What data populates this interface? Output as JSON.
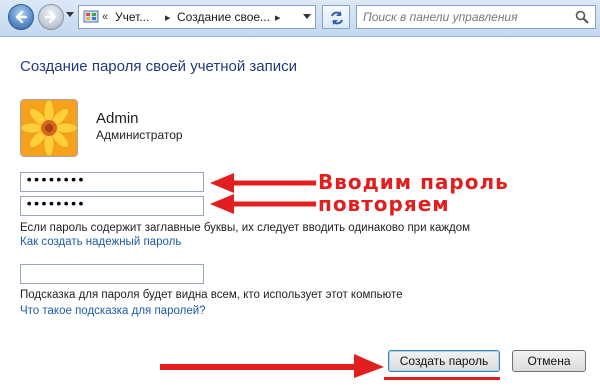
{
  "nav": {
    "breadcrumbs": [
      "Учет...",
      "Создание свое..."
    ],
    "search_placeholder": "Поиск в панели управления"
  },
  "page": {
    "heading": "Создание пароля своей учетной записи",
    "user": {
      "name": "Admin",
      "role": "Администратор"
    },
    "password_value": "••••••••",
    "confirm_value": "••••••••",
    "hint_value": "",
    "case_note": "Если пароль содержит заглавные буквы, их следует вводить одинаково при каждом",
    "strong_password_link": "Как создать надежный пароль",
    "hint_note": "Подсказка для пароля будет видна всем, кто использует этот компьюте",
    "hint_link": "Что такое подсказка для паролей?"
  },
  "annotations": {
    "enter_password": "Вводим пароль",
    "repeat": "повторяем",
    "color": "#e21e1e"
  },
  "buttons": {
    "create": "Создать пароль",
    "cancel": "Отмена"
  }
}
